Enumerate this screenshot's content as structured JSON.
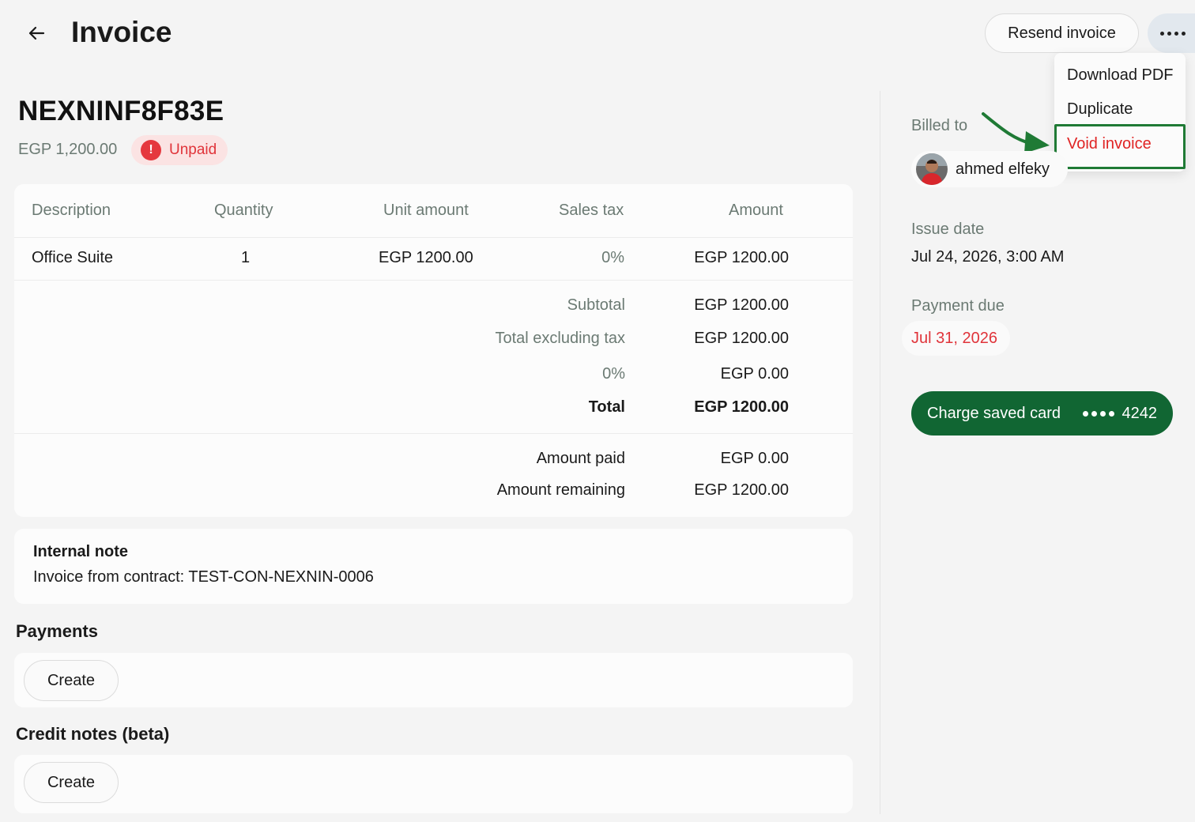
{
  "header": {
    "title": "Invoice",
    "resend_label": "Resend invoice"
  },
  "menu": {
    "items": [
      "Download PDF",
      "Duplicate",
      "Void invoice"
    ]
  },
  "invoice": {
    "number": "NEXNINF8F83E",
    "amount": "EGP 1,200.00",
    "status": "Unpaid",
    "status_icon": "!"
  },
  "table": {
    "headers": {
      "description": "Description",
      "quantity": "Quantity",
      "unit_amount": "Unit amount",
      "sales_tax": "Sales tax",
      "amount": "Amount"
    },
    "rows": [
      {
        "description": "Office Suite",
        "quantity": "1",
        "unit_amount": "EGP 1200.00",
        "sales_tax": "0%",
        "amount": "EGP 1200.00"
      }
    ],
    "totals": {
      "subtotal_label": "Subtotal",
      "subtotal_value": "EGP 1200.00",
      "excl_tax_label": "Total excluding tax",
      "excl_tax_value": "EGP 1200.00",
      "tax_label": "0%",
      "tax_value": "EGP 0.00",
      "total_label": "Total",
      "total_value": "EGP 1200.00",
      "paid_label": "Amount paid",
      "paid_value": "EGP 0.00",
      "remaining_label": "Amount remaining",
      "remaining_value": "EGP 1200.00"
    }
  },
  "note": {
    "title": "Internal note",
    "text": "Invoice from contract: TEST-CON-NEXNIN-0006"
  },
  "payments": {
    "title": "Payments",
    "create_label": "Create"
  },
  "credit_notes": {
    "title": "Credit notes (beta)",
    "create_label": "Create"
  },
  "sidebar": {
    "billed_to_label": "Billed to",
    "customer_name": "ahmed elfeky",
    "issue_date_label": "Issue date",
    "issue_date": "Jul 24, 2026, 3:00 AM",
    "payment_due_label": "Payment due",
    "payment_due": "Jul 31, 2026",
    "charge_label": "Charge saved card",
    "card_last4": "4242"
  },
  "colors": {
    "accent_green": "#116633",
    "danger_red": "#e0343a",
    "highlight_green": "#1f7a35",
    "muted_text": "#6b7a73"
  }
}
